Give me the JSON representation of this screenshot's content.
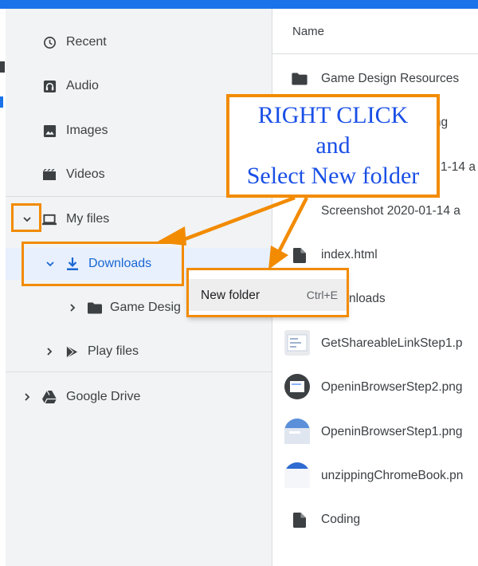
{
  "sidebar": {
    "recent": "Recent",
    "audio": "Audio",
    "images": "Images",
    "videos": "Videos",
    "my_files": "My files",
    "downloads": "Downloads",
    "game_design": "Game Desig",
    "play_files": "Play files",
    "google_drive": "Google Drive"
  },
  "content": {
    "name_header": "Name",
    "files": [
      {
        "name": "Game Design Resources",
        "icon": "folder-icon"
      },
      {
        "name": ".png",
        "icon": "image-icon"
      },
      {
        "name": "1-14 a",
        "icon": "image-icon"
      },
      {
        "name": "Screenshot 2020-01-14 a",
        "icon": "image-icon"
      },
      {
        "name": "index.html",
        "icon": "file-icon"
      },
      {
        "name": "nloads",
        "icon": "folder-icon"
      },
      {
        "name": "GetShareableLinkStep1.p",
        "icon": "image-thumb"
      },
      {
        "name": "OpeninBrowserStep2.png",
        "icon": "image-thumb"
      },
      {
        "name": "OpeninBrowserStep1.png",
        "icon": "image-thumb"
      },
      {
        "name": "unzippingChromeBook.pn",
        "icon": "image-thumb"
      },
      {
        "name": "Coding",
        "icon": "file-icon"
      }
    ]
  },
  "context_menu": {
    "new_folder": "New folder",
    "shortcut": "Ctrl+E"
  },
  "callout": {
    "line1": "RIGHT CLICK",
    "line2": "and",
    "line3": "Select New folder"
  },
  "colors": {
    "accent": "#1a73e8",
    "highlight": "#f28b00",
    "callout_text": "#1a4fe6",
    "sidebar_bg": "#f1f3f4",
    "selected_bg": "#e8f0fe"
  }
}
